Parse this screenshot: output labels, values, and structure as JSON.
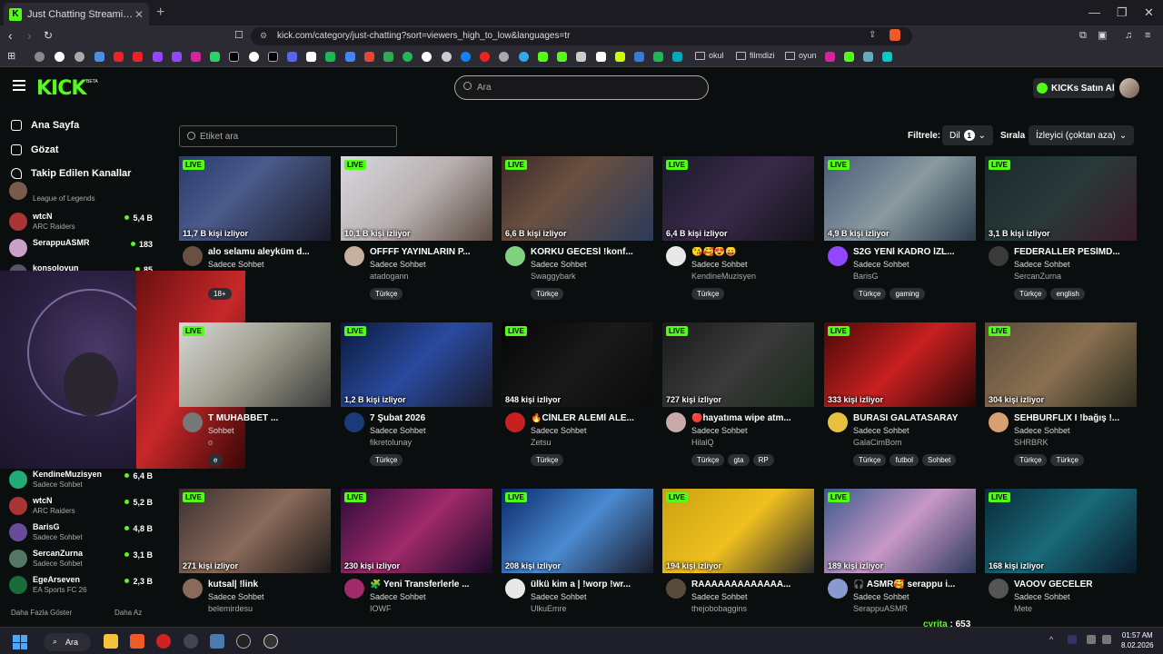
{
  "browser": {
    "tab_title": "Just Chatting Streaming - Live St",
    "new_tab": "+",
    "url": "kick.com/category/just-chatting?sort=viewers_high_to_low&languages=tr",
    "bookmark_folders": [
      "okul",
      "filmdizi",
      "oyun"
    ]
  },
  "header": {
    "logo": "KICK",
    "beta": "BETA",
    "search_placeholder": "Ara",
    "buy_kicks": "KICKs Satın Al"
  },
  "sidebar": {
    "nav": [
      "Ana Sayfa",
      "Gözat",
      "Takip Edilen Kanallar"
    ],
    "channels_top": [
      {
        "name": "",
        "category": "League of Legends",
        "viewers": ""
      },
      {
        "name": "wtcN",
        "category": "ARC Raiders",
        "viewers": "5,4 B"
      },
      {
        "name": "SerappuASMR",
        "category": "",
        "viewers": "183"
      },
      {
        "name": "konsolovun",
        "category": "",
        "viewers": "85"
      }
    ],
    "channels_bottom": [
      {
        "name": "KendineMuzisyen",
        "category": "Sadece Sohbet",
        "viewers": "6,4 B"
      },
      {
        "name": "wtcN",
        "category": "ARC Raiders",
        "viewers": "5,2 B"
      },
      {
        "name": "BarisG",
        "category": "Sadece Sohbet",
        "viewers": "4,8 B"
      },
      {
        "name": "SercanZurna",
        "category": "Sadece Sohbet",
        "viewers": "3,1 B"
      },
      {
        "name": "EgeArseven",
        "category": "EA Sports FC 26",
        "viewers": "2,3 B"
      }
    ],
    "show_more": "Daha Fazla Göster",
    "show_less": "Daha Az"
  },
  "filters": {
    "tag_search_placeholder": "Etiket ara",
    "filter_label": "Filtrele:",
    "language_label": "Dil",
    "language_count": "1",
    "sort_label": "Sırala",
    "sort_value": "İzleyici (çoktan aza)"
  },
  "live_label": "LIVE",
  "streams": [
    {
      "viewers": "11,7 B kişi izliyor",
      "title": "alo selamu aleyküm d...",
      "category": "Sadece Sohbet",
      "channel": "",
      "tags": [
        "18+"
      ]
    },
    {
      "viewers": "10,1 B kişi izliyor",
      "title": "OFFFF YAYINLARIN P...",
      "category": "Sadece Sohbet",
      "channel": "atadogann",
      "tags": [
        "Türkçe"
      ]
    },
    {
      "viewers": "6,6 B kişi izliyor",
      "title": "KORKU GECESİ !konf...",
      "category": "Sadece Sohbet",
      "channel": "Swaggybark",
      "tags": [
        "Türkçe"
      ]
    },
    {
      "viewers": "6,4 B kişi izliyor",
      "title": "😘🥰😍😛",
      "category": "Sadece Sohbet",
      "channel": "KendineMuzisyen",
      "tags": [
        "Türkçe"
      ]
    },
    {
      "viewers": "4,9 B kişi izliyor",
      "title": "S2G YENİ KADRO İZL...",
      "category": "Sadece Sohbet",
      "channel": "BarisG",
      "tags": [
        "Türkçe",
        "gaming"
      ]
    },
    {
      "viewers": "3,1 B kişi izliyor",
      "title": "FEDERALLER PESİMD...",
      "category": "Sadece Sohbet",
      "channel": "SercanZurna",
      "tags": [
        "Türkçe",
        "english"
      ]
    },
    {
      "viewers": "",
      "title": "T MUHABBET ...",
      "category": "Sohbet",
      "channel": "o",
      "tags": [
        "e"
      ]
    },
    {
      "viewers": "1,2 B kişi izliyor",
      "title": "7 Şubat 2026",
      "category": "Sadece Sohbet",
      "channel": "fikretolunay",
      "tags": [
        "Türkçe"
      ]
    },
    {
      "viewers": "848 kişi izliyor",
      "title": "🔥CİNLER ALEMİ ALE...",
      "category": "Sadece Sohbet",
      "channel": "Zetsu",
      "tags": [
        "Türkçe"
      ]
    },
    {
      "viewers": "727 kişi izliyor",
      "title": "🔴hayatıma wipe atm...",
      "category": "Sadece Sohbet",
      "channel": "HilalQ",
      "tags": [
        "Türkçe",
        "gta",
        "RP"
      ]
    },
    {
      "viewers": "333 kişi izliyor",
      "title": "BURASI GALATASARAY",
      "category": "Sadece Sohbet",
      "channel": "GalaCimBom",
      "tags": [
        "Türkçe",
        "futbol",
        "Sohbet"
      ]
    },
    {
      "viewers": "304 kişi izliyor",
      "title": "SEHBURFLIX I !bağış !...",
      "category": "Sadece Sohbet",
      "channel": "SHRBRK",
      "tags": [
        "Türkçe",
        "Türkçe"
      ]
    },
    {
      "viewers": "271 kişi izliyor",
      "title": "kutsal| !link",
      "category": "Sadece Sohbet",
      "channel": "belemirdesu",
      "tags": []
    },
    {
      "viewers": "230 kişi izliyor",
      "title": "🧩 Yeni Transferlerle ...",
      "category": "Sadece Sohbet",
      "channel": "IOWF",
      "tags": []
    },
    {
      "viewers": "208 kişi izliyor",
      "title": "ülkü kim a | !worp !wr...",
      "category": "Sadece Sohbet",
      "channel": "UlkuEmre",
      "tags": []
    },
    {
      "viewers": "194 kişi izliyor",
      "title": "RAAAAAAAAAAAAA...",
      "category": "Sadece Sohbet",
      "channel": "thejobobaggins",
      "tags": []
    },
    {
      "viewers": "189 kişi izliyor",
      "title": "🎧 ASMR🥰 serappu i...",
      "category": "Sadece Sohbet",
      "channel": "SerappuASMR",
      "tags": []
    },
    {
      "viewers": "168 kişi izliyor",
      "title": "VAOOV GECELER",
      "category": "Sadece Sohbet",
      "channel": "Mete",
      "tags": []
    }
  ],
  "overlay_info": {
    "name": "cyrita",
    "count": "653"
  },
  "taskbar": {
    "search": "Ara",
    "time": "01:57 AM",
    "date": "8.02.2026"
  }
}
